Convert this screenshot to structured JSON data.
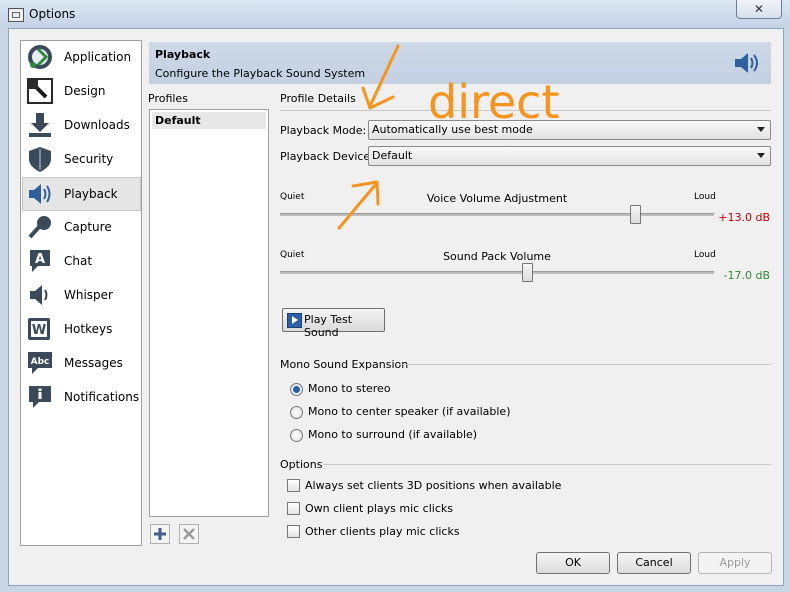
{
  "window": {
    "title": "Options",
    "close_label": "✕"
  },
  "nav": {
    "items": [
      {
        "label": "Application",
        "icon": "application-icon"
      },
      {
        "label": "Design",
        "icon": "design-icon"
      },
      {
        "label": "Downloads",
        "icon": "downloads-icon"
      },
      {
        "label": "Security",
        "icon": "shield-icon"
      },
      {
        "label": "Playback",
        "icon": "speaker-icon",
        "selected": true
      },
      {
        "label": "Capture",
        "icon": "microphone-icon"
      },
      {
        "label": "Chat",
        "icon": "chat-icon"
      },
      {
        "label": "Whisper",
        "icon": "whisper-icon"
      },
      {
        "label": "Hotkeys",
        "icon": "hotkeys-icon"
      },
      {
        "label": "Messages",
        "icon": "messages-icon"
      },
      {
        "label": "Notifications",
        "icon": "notifications-icon"
      }
    ]
  },
  "header": {
    "title": "Playback",
    "subtitle": "Configure the Playback Sound System"
  },
  "profiles": {
    "label": "Profiles",
    "items": [
      "Default"
    ]
  },
  "details": {
    "label": "Profile Details",
    "playback_mode": {
      "label": "Playback Mode:",
      "value": "Automatically use best mode"
    },
    "playback_device": {
      "label": "Playback Device:",
      "value": "Default"
    },
    "voice_volume": {
      "quiet": "Quiet",
      "title": "Voice Volume Adjustment",
      "loud": "Loud",
      "value_label": "+13.0 dB",
      "value_color": "#c00000",
      "position": 0.82
    },
    "soundpack_volume": {
      "quiet": "Quiet",
      "title": "Sound Pack Volume",
      "loud": "Loud",
      "value_label": "-17.0 dB",
      "value_color": "#2e8b2e",
      "position": 0.57
    },
    "test_button": "Play Test Sound"
  },
  "mono": {
    "label": "Mono Sound Expansion",
    "options": [
      {
        "label": "Mono to stereo",
        "selected": true
      },
      {
        "label": "Mono to center speaker (if available)",
        "selected": false
      },
      {
        "label": "Mono to surround (if available)",
        "selected": false
      }
    ]
  },
  "options": {
    "label": "Options",
    "items": [
      {
        "label": "Always set clients 3D positions when available",
        "checked": false
      },
      {
        "label": "Own client plays mic clicks",
        "checked": false
      },
      {
        "label": "Other clients play mic clicks",
        "checked": false
      }
    ]
  },
  "buttons": {
    "ok": "OK",
    "cancel": "Cancel",
    "apply": "Apply"
  },
  "annotation": {
    "text": "direct",
    "color": "#f7941d"
  }
}
